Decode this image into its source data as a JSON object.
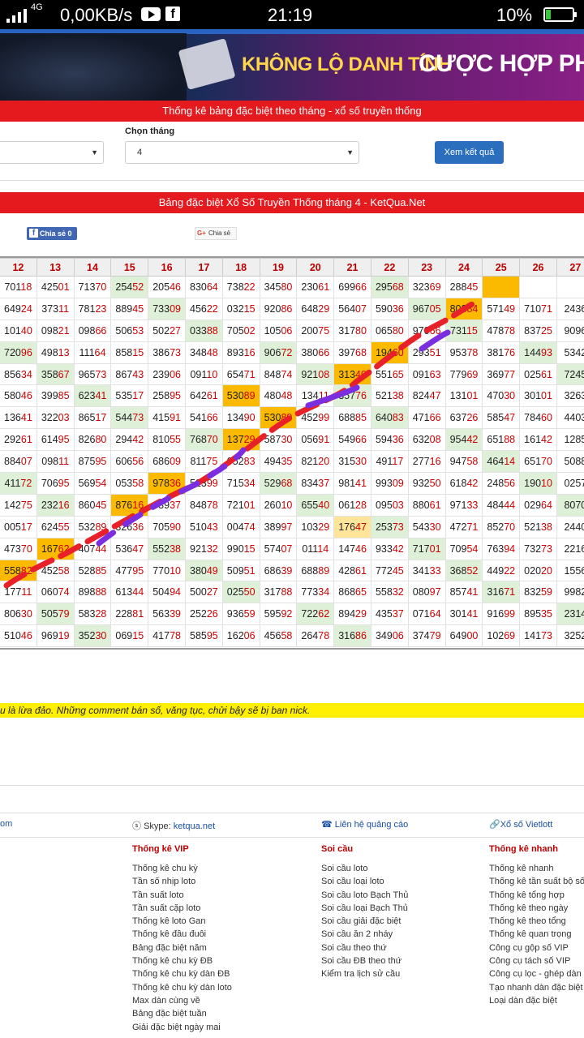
{
  "statusbar": {
    "network": "4G",
    "speed": "0,00KB/s",
    "time": "21:19",
    "battery": "10%"
  },
  "banner": {
    "text1": "KHÔNG LỘ DANH TÍNH",
    "text2": "CƯỢC HỢP PHÁP"
  },
  "header_title": "Thống kê bảng đặc biệt theo tháng - xổ số truyền thống",
  "form": {
    "month_label": "Chọn tháng",
    "month_value": "4",
    "submit": "Xem kết quả"
  },
  "table_title": "Bảng đặc biệt Xổ Số Truyền Thống tháng 4 - KetQua.Net",
  "share": {
    "facebook": "Chia sẻ",
    "facebook_count": "0",
    "google": "Chia sẻ"
  },
  "columns": [
    "12",
    "13",
    "14",
    "15",
    "16",
    "17",
    "18",
    "19",
    "20",
    "21",
    "22",
    "23",
    "24",
    "25",
    "26",
    "27"
  ],
  "rows": [
    [
      "70118",
      "42501",
      "71370",
      "25452",
      "20546",
      "83064",
      "73822",
      "34580",
      "23061",
      "69966",
      "29568",
      "32369",
      "28845",
      "",
      "",
      " "
    ],
    [
      "64924",
      "37311",
      "78123",
      "88945",
      "73309",
      "45622",
      "03215",
      "92086",
      "64829",
      "56407",
      "59036",
      "96705",
      "80384",
      "57149",
      "71071",
      "2436"
    ],
    [
      "10140",
      "09821",
      "09866",
      "50653",
      "50227",
      "03388",
      "70502",
      "10506",
      "20075",
      "31780",
      "06580",
      "97066",
      "73115",
      "47878",
      "83725",
      "9096"
    ],
    [
      "72096",
      "49813",
      "11164",
      "85815",
      "38673",
      "34848",
      "89316",
      "90672",
      "38066",
      "39768",
      "19460",
      "29351",
      "95378",
      "38176",
      "14493",
      "5342"
    ],
    [
      "85634",
      "35867",
      "96573",
      "86743",
      "23906",
      "09110",
      "65471",
      "84874",
      "92108",
      "31340",
      "55165",
      "09163",
      "77969",
      "36977",
      "02561",
      "7245"
    ],
    [
      "58046",
      "39985",
      "62341",
      "53517",
      "25895",
      "64261",
      "53089",
      "48048",
      "13411",
      "35776",
      "52138",
      "82447",
      "13101",
      "47030",
      "30101",
      "3263"
    ],
    [
      "13641",
      "32203",
      "86517",
      "54473",
      "41591",
      "54166",
      "13490",
      "53089",
      "45299",
      "68885",
      "64083",
      "47166",
      "63726",
      "58547",
      "78460",
      "4403"
    ],
    [
      "29261",
      "61495",
      "82680",
      "29442",
      "81055",
      "76870",
      "13729",
      "58730",
      "05691",
      "54966",
      "59436",
      "63208",
      "95442",
      "65188",
      "16142",
      "1285"
    ],
    [
      "88407",
      "09811",
      "87595",
      "60656",
      "68609",
      "81175",
      "05283",
      "49435",
      "82120",
      "31530",
      "49117",
      "27716",
      "94758",
      "46414",
      "65170",
      "5088"
    ],
    [
      "41172",
      "70695",
      "56954",
      "05358",
      "97836",
      "52399",
      "71534",
      "52968",
      "83437",
      "98141",
      "99309",
      "93250",
      "61842",
      "24856",
      "19010",
      "0257"
    ],
    [
      "14275",
      "23216",
      "86045",
      "87616",
      "83937",
      "84878",
      "72101",
      "26010",
      "65540",
      "06128",
      "09503",
      "88061",
      "97133",
      "48444",
      "02964",
      "8070"
    ],
    [
      "00517",
      "62455",
      "53289",
      "32636",
      "70590",
      "51043",
      "00474",
      "38997",
      "10329",
      "17647",
      "25373",
      "54330",
      "47271",
      "85270",
      "52138",
      "2440"
    ],
    [
      "47370",
      "16762",
      "40744",
      "53647",
      "55238",
      "92132",
      "99015",
      "57407",
      "01114",
      "14746",
      "93342",
      "71701",
      "70954",
      "76394",
      "73273",
      "2216"
    ],
    [
      "55882",
      "45258",
      "52885",
      "47795",
      "77010",
      "38049",
      "50951",
      "68639",
      "68889",
      "42861",
      "77245",
      "34133",
      "36852",
      "44922",
      "02020",
      "1556"
    ],
    [
      "17711",
      "06074",
      "89888",
      "61344",
      "50494",
      "50027",
      "02550",
      "31788",
      "77334",
      "86865",
      "55832",
      "08097",
      "85741",
      "31671",
      "83259",
      "9982"
    ],
    [
      "80630",
      "50579",
      "58328",
      "22881",
      "56339",
      "25226",
      "93659",
      "59592",
      "72262",
      "89429",
      "43537",
      "07164",
      "30141",
      "91699",
      "89535",
      "2314"
    ],
    [
      "51046",
      "96919",
      "35230",
      "06915",
      "41778",
      "58595",
      "16206",
      "45658",
      "26478",
      "31686",
      "34906",
      "37479",
      "64900",
      "10269",
      "14173",
      "3252"
    ]
  ],
  "warning": "u là lừa đảo. Những comment bán số, văng tục, chửi bậy sẽ bị ban nick.",
  "footer": {
    "top_links": [
      "om",
      "Skype: ",
      "ketqua.net",
      "Liên hệ quảng cáo",
      "Xổ số Vietlott"
    ],
    "vip_title": "Thống kê VIP",
    "vip": [
      "Thống kê chu kỳ",
      "Tần số nhịp loto",
      "Tần suất loto",
      "Tần suất cặp loto",
      "Thống kê loto Gan",
      "Thống kê đầu đuôi",
      "Bảng đặc biệt năm",
      "Thống kê chu kỳ ĐB",
      "Thống kê chu kỳ dàn ĐB",
      "Thống kê chu kỳ dàn loto",
      "Max dàn cùng về",
      "Bảng đặc biệt tuần",
      "Giải đặc biệt ngày mai"
    ],
    "soi_title": "Soi cầu",
    "soi": [
      "Soi cầu loto",
      "Soi cầu loại loto",
      "Soi cầu loto Bạch Thủ",
      "Soi cầu loại Bạch Thủ",
      "Soi cầu giải đặc biệt",
      "Soi cầu ăn 2 nháy",
      "Soi cầu theo thứ",
      "Soi cầu ĐB theo thứ",
      "Kiểm tra lịch sử cầu"
    ],
    "nhanh_title": "Thống kê nhanh",
    "nhanh": [
      "Thống kê nhanh",
      "Thống kê tần suất bộ số",
      "Thống kê tổng hợp",
      "Thống kê theo ngày",
      "Thống kê theo tổng",
      "Thống kê quan trọng",
      "Công cụ gộp số VIP",
      "Công cụ tách số VIP",
      "Công cụ lọc - ghép dàn",
      "Tạo nhanh dàn đặc biệt",
      "Loại dàn đặc biệt"
    ]
  }
}
